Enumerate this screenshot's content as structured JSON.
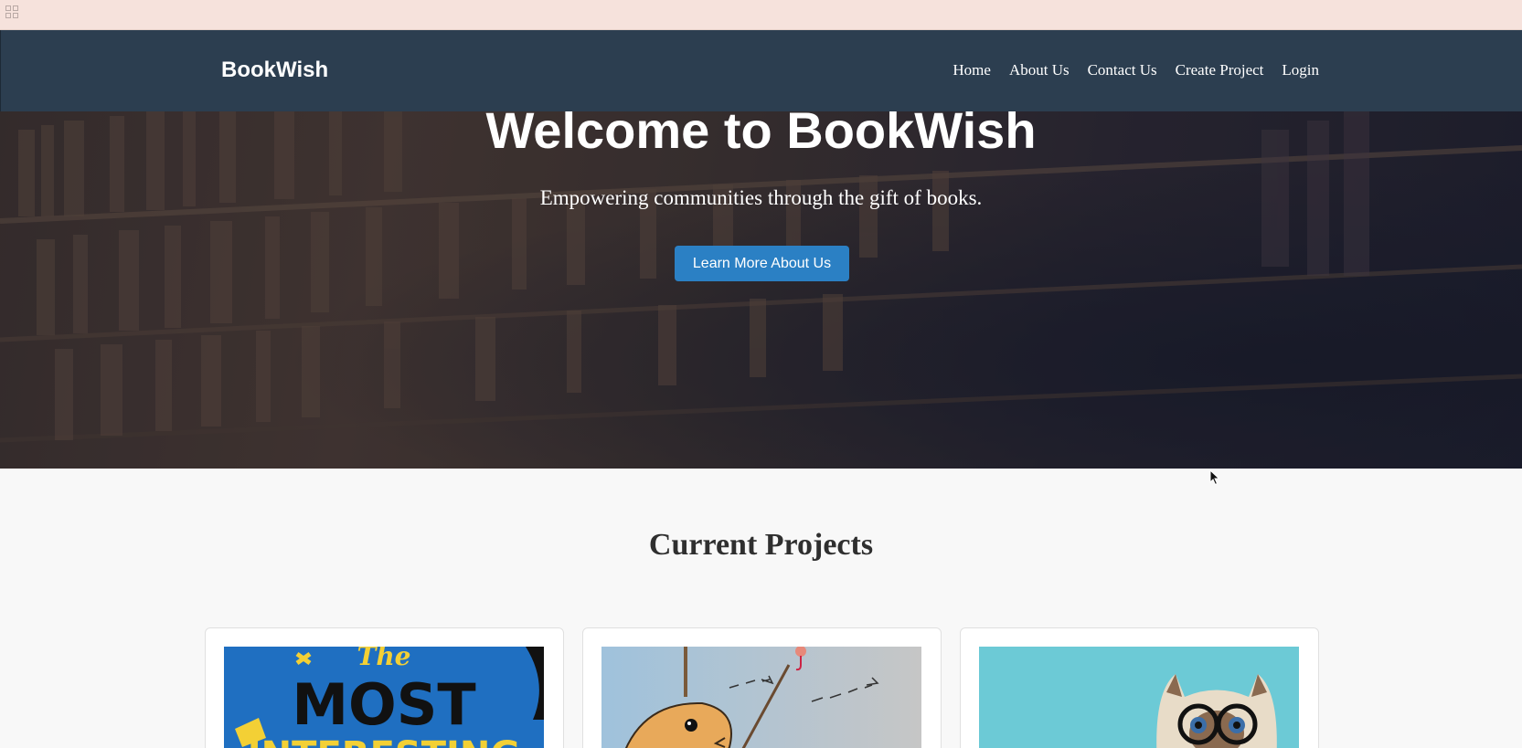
{
  "nav": {
    "brand": "BookWish",
    "links": [
      "Home",
      "About Us",
      "Contact Us",
      "Create Project",
      "Login"
    ]
  },
  "hero": {
    "title": "Welcome to BookWish",
    "subtitle": "Empowering communities through the gift of books.",
    "button_label": "Learn More About Us"
  },
  "projects": {
    "heading": "Current Projects",
    "cards": [
      {
        "image": "book-cover-most-interesting",
        "cover_text": [
          "The",
          "MOST",
          "INTERESTING"
        ]
      },
      {
        "image": "fish-illustration"
      },
      {
        "image": "cat-with-glasses"
      }
    ]
  },
  "colors": {
    "nav_bg": "#2c3e50",
    "button_bg": "#2b80c4",
    "page_bg": "#f8f8f8",
    "browser_strip": "#f6e2dc"
  }
}
